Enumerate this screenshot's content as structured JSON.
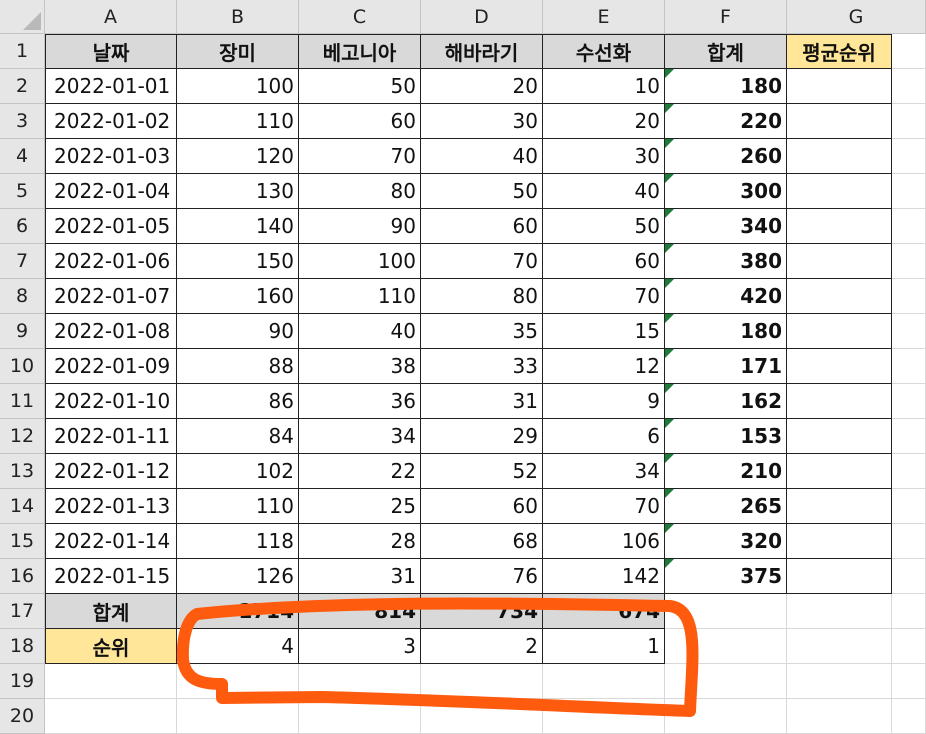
{
  "columns": [
    "A",
    "B",
    "C",
    "D",
    "E",
    "F",
    "G"
  ],
  "rows": [
    "1",
    "2",
    "3",
    "4",
    "5",
    "6",
    "7",
    "8",
    "9",
    "10",
    "11",
    "12",
    "13",
    "14",
    "15",
    "16",
    "17",
    "18",
    "19",
    "20"
  ],
  "headers": [
    "날짜",
    "장미",
    "베고니아",
    "해바라기",
    "수선화",
    "합계",
    "평균순위"
  ],
  "data": [
    [
      "2022-01-01",
      "100",
      "50",
      "20",
      "10",
      "180"
    ],
    [
      "2022-01-02",
      "110",
      "60",
      "30",
      "20",
      "220"
    ],
    [
      "2022-01-03",
      "120",
      "70",
      "40",
      "30",
      "260"
    ],
    [
      "2022-01-04",
      "130",
      "80",
      "50",
      "40",
      "300"
    ],
    [
      "2022-01-05",
      "140",
      "90",
      "60",
      "50",
      "340"
    ],
    [
      "2022-01-06",
      "150",
      "100",
      "70",
      "60",
      "380"
    ],
    [
      "2022-01-07",
      "160",
      "110",
      "80",
      "70",
      "420"
    ],
    [
      "2022-01-08",
      "90",
      "40",
      "35",
      "15",
      "180"
    ],
    [
      "2022-01-09",
      "88",
      "38",
      "33",
      "12",
      "171"
    ],
    [
      "2022-01-10",
      "86",
      "36",
      "31",
      "9",
      "162"
    ],
    [
      "2022-01-11",
      "84",
      "34",
      "29",
      "6",
      "153"
    ],
    [
      "2022-01-12",
      "102",
      "22",
      "52",
      "34",
      "210"
    ],
    [
      "2022-01-13",
      "110",
      "25",
      "60",
      "70",
      "265"
    ],
    [
      "2022-01-14",
      "118",
      "28",
      "68",
      "106",
      "320"
    ],
    [
      "2022-01-15",
      "126",
      "31",
      "76",
      "142",
      "375"
    ]
  ],
  "totals": {
    "label": "합계",
    "values": [
      "1714",
      "814",
      "734",
      "674"
    ]
  },
  "ranks": {
    "label": "순위",
    "values": [
      "4",
      "3",
      "2",
      "1"
    ]
  },
  "colors": {
    "header_fill": "#d9d9d9",
    "highlight_fill": "#ffe699",
    "annotation": "#ff5b0f",
    "error_indicator": "#1e7b3a"
  }
}
